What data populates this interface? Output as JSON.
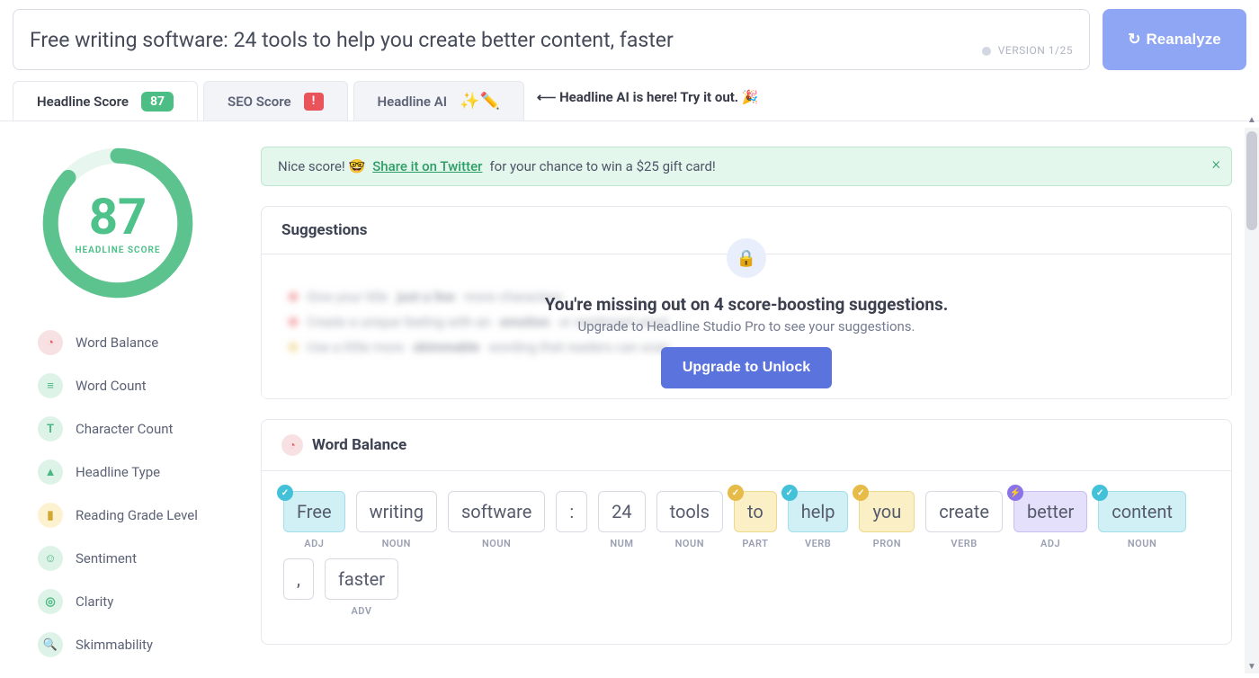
{
  "header": {
    "headline": "Free writing software: 24 tools to help you create better content, faster",
    "version_label": "VERSION 1/25",
    "reanalyze": "Reanalyze"
  },
  "tabs": {
    "headline_score": {
      "label": "Headline Score",
      "badge": "87"
    },
    "seo_score": {
      "label": "SEO Score"
    },
    "headline_ai": {
      "label": "Headline AI"
    },
    "ai_promo": "⟵ Headline AI is here! Try it out. 🎉"
  },
  "score": {
    "value": "87",
    "label": "HEADLINE\nSCORE"
  },
  "nav": [
    {
      "label": "Word Balance",
      "icon_bg": "#f8e1e3",
      "icon_fg": "#e25b63",
      "glyph": "◔"
    },
    {
      "label": "Word Count",
      "icon_bg": "#def3e8",
      "icon_fg": "#49b981",
      "glyph": "≡"
    },
    {
      "label": "Character Count",
      "icon_bg": "#def3e8",
      "icon_fg": "#49b981",
      "glyph": "T"
    },
    {
      "label": "Headline Type",
      "icon_bg": "#def3e8",
      "icon_fg": "#49b981",
      "glyph": "▲"
    },
    {
      "label": "Reading Grade Level",
      "icon_bg": "#fdf2cf",
      "icon_fg": "#d2a832",
      "glyph": "▮"
    },
    {
      "label": "Sentiment",
      "icon_bg": "#def3e8",
      "icon_fg": "#49b981",
      "glyph": "☺"
    },
    {
      "label": "Clarity",
      "icon_bg": "#def3e8",
      "icon_fg": "#49b981",
      "glyph": "◎"
    },
    {
      "label": "Skimmability",
      "icon_bg": "#def3e8",
      "icon_fg": "#49b981",
      "glyph": "🔍"
    }
  ],
  "banner": {
    "prefix": "Nice score! 🤓 ",
    "link": "Share it on Twitter",
    "suffix": " for your chance to win a $25 gift card!"
  },
  "suggestions": {
    "title": "Suggestions",
    "headline": "You're missing out on 4 score-boosting suggestions.",
    "sub": "Upgrade to Headline Studio Pro to see your suggestions.",
    "button": "Upgrade to Unlock"
  },
  "word_balance": {
    "title": "Word Balance",
    "words": [
      {
        "text": "Free",
        "pos": "ADJ",
        "color": "cyan",
        "mark": "m-cyan"
      },
      {
        "text": "writing",
        "pos": "NOUN",
        "color": "",
        "mark": ""
      },
      {
        "text": "software",
        "pos": "NOUN",
        "color": "",
        "mark": ""
      },
      {
        "text": ":",
        "pos": "",
        "color": "",
        "mark": ""
      },
      {
        "text": "24",
        "pos": "NUM",
        "color": "",
        "mark": ""
      },
      {
        "text": "tools",
        "pos": "NOUN",
        "color": "",
        "mark": ""
      },
      {
        "text": "to",
        "pos": "PART",
        "color": "yellow",
        "mark": "m-yellow"
      },
      {
        "text": "help",
        "pos": "VERB",
        "color": "cyan",
        "mark": "m-cyan"
      },
      {
        "text": "you",
        "pos": "PRON",
        "color": "yellow",
        "mark": "m-yellow"
      },
      {
        "text": "create",
        "pos": "VERB",
        "color": "",
        "mark": ""
      },
      {
        "text": "better",
        "pos": "ADJ",
        "color": "purple",
        "mark": "m-purple"
      },
      {
        "text": "content",
        "pos": "NOUN",
        "color": "cyan",
        "mark": "m-cyan"
      },
      {
        "text": ",",
        "pos": "",
        "color": "",
        "mark": ""
      },
      {
        "text": "faster",
        "pos": "ADV",
        "color": "",
        "mark": ""
      }
    ]
  }
}
